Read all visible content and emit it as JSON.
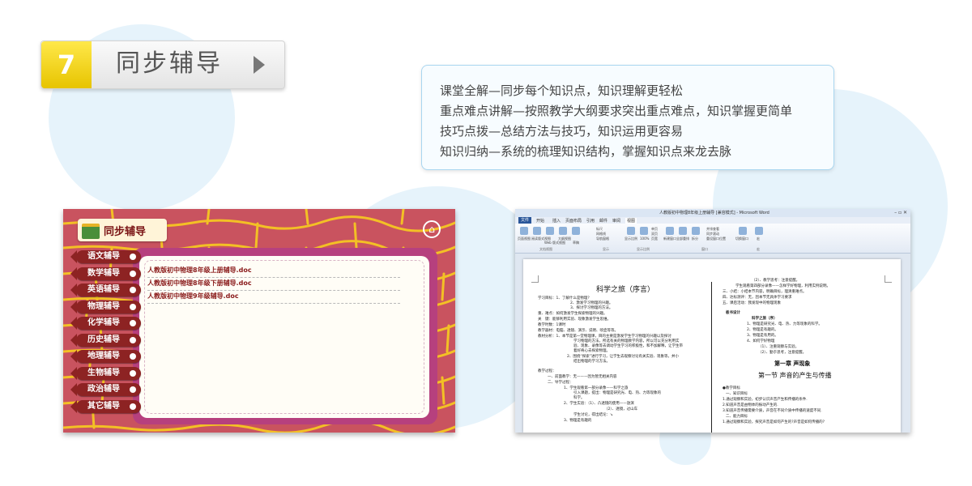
{
  "section": {
    "number": "7",
    "title": "同步辅导"
  },
  "description": {
    "lines": [
      "课堂全解—同步每个知识点，知识理解更轻松",
      "重点难点讲解—按照教学大纲要求突出重点难点，知识掌握更简单",
      "技巧点拨—总结方法与技巧，知识运用更容易",
      "知识归纳—系统的梳理知识结构，掌握知识点来龙去脉"
    ]
  },
  "app": {
    "logo_title": "同步辅导",
    "menu": [
      "语文辅导",
      "数学辅导",
      "英语辅导",
      "物理辅导",
      "化学辅导",
      "历史辅导",
      "地理辅导",
      "生物辅导",
      "政治辅导",
      "其它辅导"
    ],
    "files": [
      "人教版初中物理8年级上册辅导.doc",
      "人教版初中物理8年级下册辅导.doc",
      "人教版初中物理9年级辅导.doc"
    ]
  },
  "word": {
    "window_title": "人教版初中物理8年级上册辅导 [兼容模式] - Microsoft Word",
    "file_tab": "文件",
    "tabs": [
      "开始",
      "插入",
      "页面布局",
      "引用",
      "邮件",
      "审阅",
      "视图"
    ],
    "ribbon_labels": [
      "页面视图",
      "阅读版式视图",
      "Web 版式视图",
      "大纲视图",
      "草稿",
      "标尺",
      "网格线",
      "导航窗格",
      "显示比例",
      "100%",
      "单页",
      "双页",
      "页宽",
      "新建窗口",
      "全部重排",
      "拆分",
      "并排查看",
      "同步滚动",
      "重设窗口位置",
      "切换窗口",
      "宏"
    ],
    "ribbon_groups": [
      "文档视图",
      "显示",
      "显示比例",
      "窗口",
      "宏"
    ],
    "left_column": {
      "title": "科学之旅（序言）",
      "lines": [
        "学习目标：1、了解什么是物理？",
        "2、激发学习物理的兴趣。",
        "3、探讨学习物理的方法。",
        "重、难点：如何激发学生探索物理的兴趣。",
        "关　键：能够利用实验、现象激发学生思维。",
        "教学时数：1课时",
        "教学器材：电脑、透镜、演示、说明、喷壶等等。",
        "教材分析：1、本节是第一堂物理课，目的主要是激发学生学习物理的兴趣以及探讨",
        "学习物理的方法，所选有关的物理教学内容，所以可以充分利用实",
        "验、现象、录像等去调动学生学习的积极性，和不加解释，让学生带",
        "着好奇心去探索物理。",
        "2、围绕“探索”进行学习，让学生去观察讨论有关实验、现象等，并小",
        "结出物理的学习方法。",
        "教学过程：",
        "一、前面教学：无———因为暂无相关内容",
        "二、导学过程：",
        "1、学生观看第一部分录像——科学之旅",
        "引入课题，提出：物理是研究光、电、热、力等现象的",
        "科学。",
        "2、学生实验：（1）、凸透镜的使用——放演",
        "（2）、透镜，过山车",
        "学生讨论，得出结论：↘",
        "3、物理是有趣的"
      ]
    },
    "right_column": {
      "lines": [
        "（2）、教学思考：注意提醒。",
        "学生观看第四部分录像——怎样学好物理，利用实例说明。",
        "三、小结：小结本节内容，明确目标，理清重难点。",
        "四、达标测评：无，因本节无具体学习要求",
        "五、课后活动：我发现中的物理现象",
        "板书设计",
        "科学之旅（序）",
        "1、物理是研究光、电、热、力等现象的科学。",
        "2、物理是有趣的。",
        "3、物理是有用的。",
        "4、如何学好物理",
        "（1）、注重观察与实验。",
        "（2）、勤于思考，注意提醒。",
        "●教学目标",
        "一、知识目标",
        "1.通过观察和实验，初步认识声音产生和传播的条件.",
        "2.知道声音是由物体的振动产生的.",
        "3.知道声音传播需要介质，声音在不同介质中传播的速度不同.",
        "二、能力目标",
        "1.通过观察和实验，探究声音是如何产生的?声音是如何传播的?"
      ],
      "chapter": "第一章  声现象",
      "section": "第一节    声音的产生与传播"
    }
  }
}
